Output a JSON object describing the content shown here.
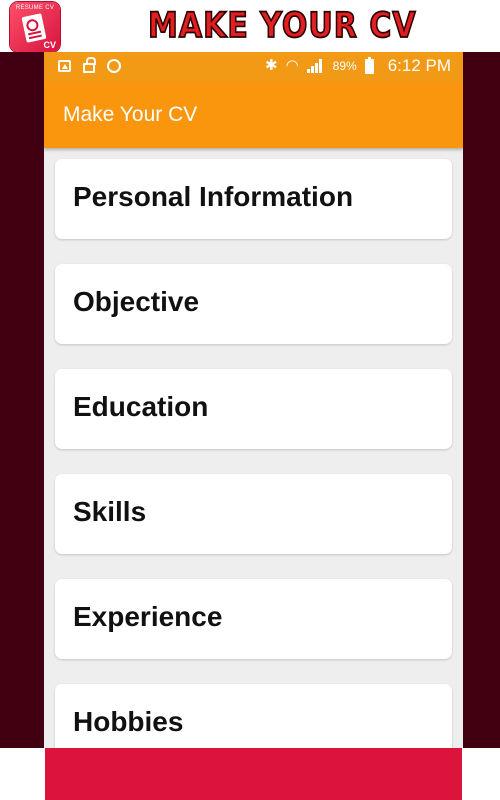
{
  "banner": {
    "logo_caption_top": "RESUME CV",
    "logo_caption_bottom": "CV",
    "title": "MAKE YOUR CV"
  },
  "status_bar": {
    "battery_percent": "89%",
    "time": "6:12 PM",
    "icons": [
      "image-icon",
      "lock-icon",
      "whatsapp-icon",
      "bluetooth-icon",
      "wifi-icon",
      "signal-icon",
      "battery-icon"
    ]
  },
  "app_bar": {
    "title": "Make Your CV"
  },
  "menu": {
    "items": [
      {
        "label": "Personal Information"
      },
      {
        "label": "Objective"
      },
      {
        "label": "Education"
      },
      {
        "label": "Skills"
      },
      {
        "label": "Experience"
      },
      {
        "label": "Hobbies"
      }
    ]
  },
  "colors": {
    "accent": "#fa960e",
    "frame": "#400011",
    "bottom_bar": "#dc143c"
  }
}
